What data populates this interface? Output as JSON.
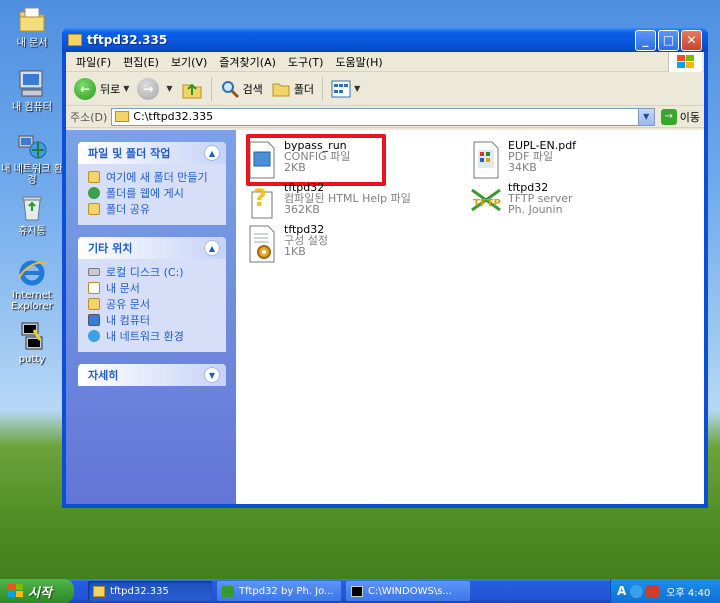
{
  "desktop": {
    "icons": [
      {
        "label": "내 문서"
      },
      {
        "label": "내 컴퓨터"
      },
      {
        "label": "내 네트워크 환경"
      },
      {
        "label": "휴지통"
      },
      {
        "label": "Internet Explorer"
      },
      {
        "label": "putty"
      }
    ]
  },
  "window": {
    "title": "tftpd32.335",
    "menu": [
      "파일(F)",
      "편집(E)",
      "보기(V)",
      "즐겨찾기(A)",
      "도구(T)",
      "도움말(H)"
    ],
    "toolbar": {
      "back": "뒤로",
      "search": "검색",
      "folders": "폴더"
    },
    "address": {
      "label": "주소(D)",
      "value": "C:\\tftpd32.335",
      "go": "이동"
    },
    "panels": [
      {
        "title": "파일 및 폴더 작업",
        "chevron": "up",
        "items": [
          "여기에 새 폴더 만들기",
          "폴더를 웹에 게시",
          "폴더 공유"
        ]
      },
      {
        "title": "기타 위치",
        "chevron": "up",
        "items": [
          "로컬 디스크 (C:)",
          "내 문서",
          "공유 문서",
          "내 컴퓨터",
          "내 네트워크 환경"
        ]
      },
      {
        "title": "자세히",
        "chevron": "down",
        "items": []
      }
    ],
    "files": [
      {
        "name": "bypass_run",
        "type": "CONFIG 파일",
        "size": "2KB",
        "icon": "config-file-icon",
        "highlighted": true
      },
      {
        "name": "EUPL-EN.pdf",
        "type": "PDF 파일",
        "size": "34KB",
        "icon": "pdf-file-icon",
        "highlighted": false
      },
      {
        "name": "tftpd32",
        "type": "컴파일된 HTML Help 파일",
        "size": "362KB",
        "icon": "help-file-icon",
        "highlighted": false
      },
      {
        "name": "tftpd32",
        "type": "TFTP server",
        "size": "Ph. Jounin",
        "icon": "tftp-app-icon",
        "highlighted": false
      },
      {
        "name": "tftpd32",
        "type": "구성 설정",
        "size": "1KB",
        "icon": "settings-file-icon",
        "highlighted": false
      }
    ]
  },
  "taskbar": {
    "start": "시작",
    "tasks": [
      {
        "label": "tftpd32.335",
        "active": true
      },
      {
        "label": "Tftpd32 by Ph. Jo...",
        "active": false
      },
      {
        "label": "C:\\WINDOWS\\s...",
        "active": false
      }
    ],
    "tray": {
      "ime": "A",
      "clock": "오후 4:40"
    }
  },
  "colors": {
    "highlight_box": "#e8151f",
    "panel_link": "#215dc6"
  }
}
